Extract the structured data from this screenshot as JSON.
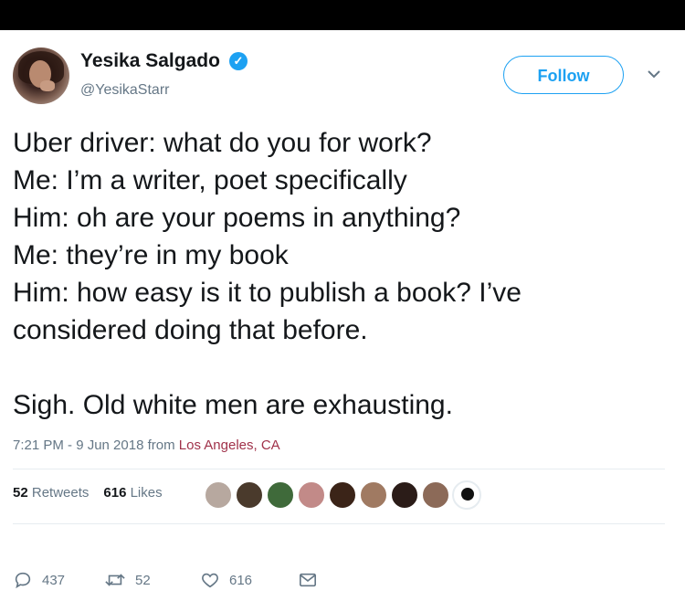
{
  "author": {
    "name": "Yesika Salgado",
    "handle": "@YesikaStarr",
    "verified_icon": "verified-badge-icon"
  },
  "follow_label": "Follow",
  "body": {
    "line1": "Uber driver: what do you for work?",
    "line2": "Me: I’m a writer, poet specifically",
    "line3": "Him: oh are your poems in anything?",
    "line4": "Me: they’re in my book",
    "line5": "Him: how easy is it to publish a book? I’ve",
    "line6": "considered doing that before.",
    "line7": "Sigh. Old white men are exhausting."
  },
  "meta": {
    "time": "7:21 PM - 9 Jun 2018 from ",
    "location": "Los Angeles, CA"
  },
  "stats": {
    "retweets_count": "52",
    "retweets_label": "Retweets",
    "likes_count": "616",
    "likes_label": "Likes"
  },
  "actions": {
    "replies": "437",
    "retweets": "52",
    "likes": "616"
  },
  "colors": {
    "accent": "#1da1f2",
    "muted": "#657786",
    "location": "#a0324a"
  }
}
